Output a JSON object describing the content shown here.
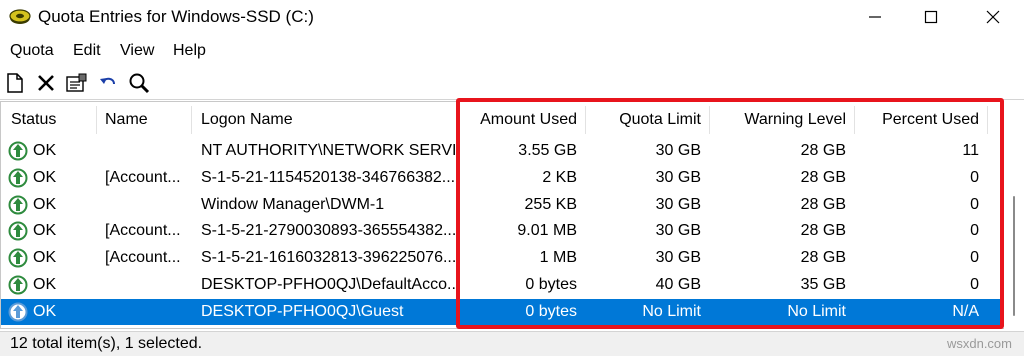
{
  "window": {
    "title": "Quota Entries for Windows-SSD (C:)"
  },
  "menu": [
    "Quota",
    "Edit",
    "View",
    "Help"
  ],
  "toolbar": {
    "icons": [
      "new-entry-icon",
      "delete-icon",
      "properties-icon",
      "undo-icon",
      "find-icon"
    ]
  },
  "columns": [
    "Status",
    "Name",
    "Logon Name",
    "Amount Used",
    "Quota Limit",
    "Warning Level",
    "Percent Used"
  ],
  "rows": [
    {
      "status": "OK",
      "name": "",
      "logon": "NT AUTHORITY\\NETWORK SERVI...",
      "used": "3.55 GB",
      "limit": "30 GB",
      "warning": "28 GB",
      "percent": "11"
    },
    {
      "status": "OK",
      "name": "[Account...",
      "logon": "S-1-5-21-1154520138-346766382...",
      "used": "2 KB",
      "limit": "30 GB",
      "warning": "28 GB",
      "percent": "0"
    },
    {
      "status": "OK",
      "name": "",
      "logon": "Window Manager\\DWM-1",
      "used": "255 KB",
      "limit": "30 GB",
      "warning": "28 GB",
      "percent": "0"
    },
    {
      "status": "OK",
      "name": "[Account...",
      "logon": "S-1-5-21-2790030893-365554382...",
      "used": "9.01 MB",
      "limit": "30 GB",
      "warning": "28 GB",
      "percent": "0"
    },
    {
      "status": "OK",
      "name": "[Account...",
      "logon": "S-1-5-21-1616032813-396225076...",
      "used": "1 MB",
      "limit": "30 GB",
      "warning": "28 GB",
      "percent": "0"
    },
    {
      "status": "OK",
      "name": "",
      "logon": "DESKTOP-PFHO0QJ\\DefaultAcco...",
      "used": "0 bytes",
      "limit": "40 GB",
      "warning": "35 GB",
      "percent": "0"
    },
    {
      "status": "OK",
      "name": "",
      "logon": "DESKTOP-PFHO0QJ\\Guest",
      "used": "0 bytes",
      "limit": "No Limit",
      "warning": "No Limit",
      "percent": "N/A"
    }
  ],
  "selected_row": 6,
  "statusbar": {
    "text": "12 total item(s), 1 selected."
  },
  "watermark": "wsxdn.com",
  "colors": {
    "selection": "#0078d7",
    "highlight_box": "#e8141c",
    "status_ok_icon": "#2e8b3e"
  }
}
